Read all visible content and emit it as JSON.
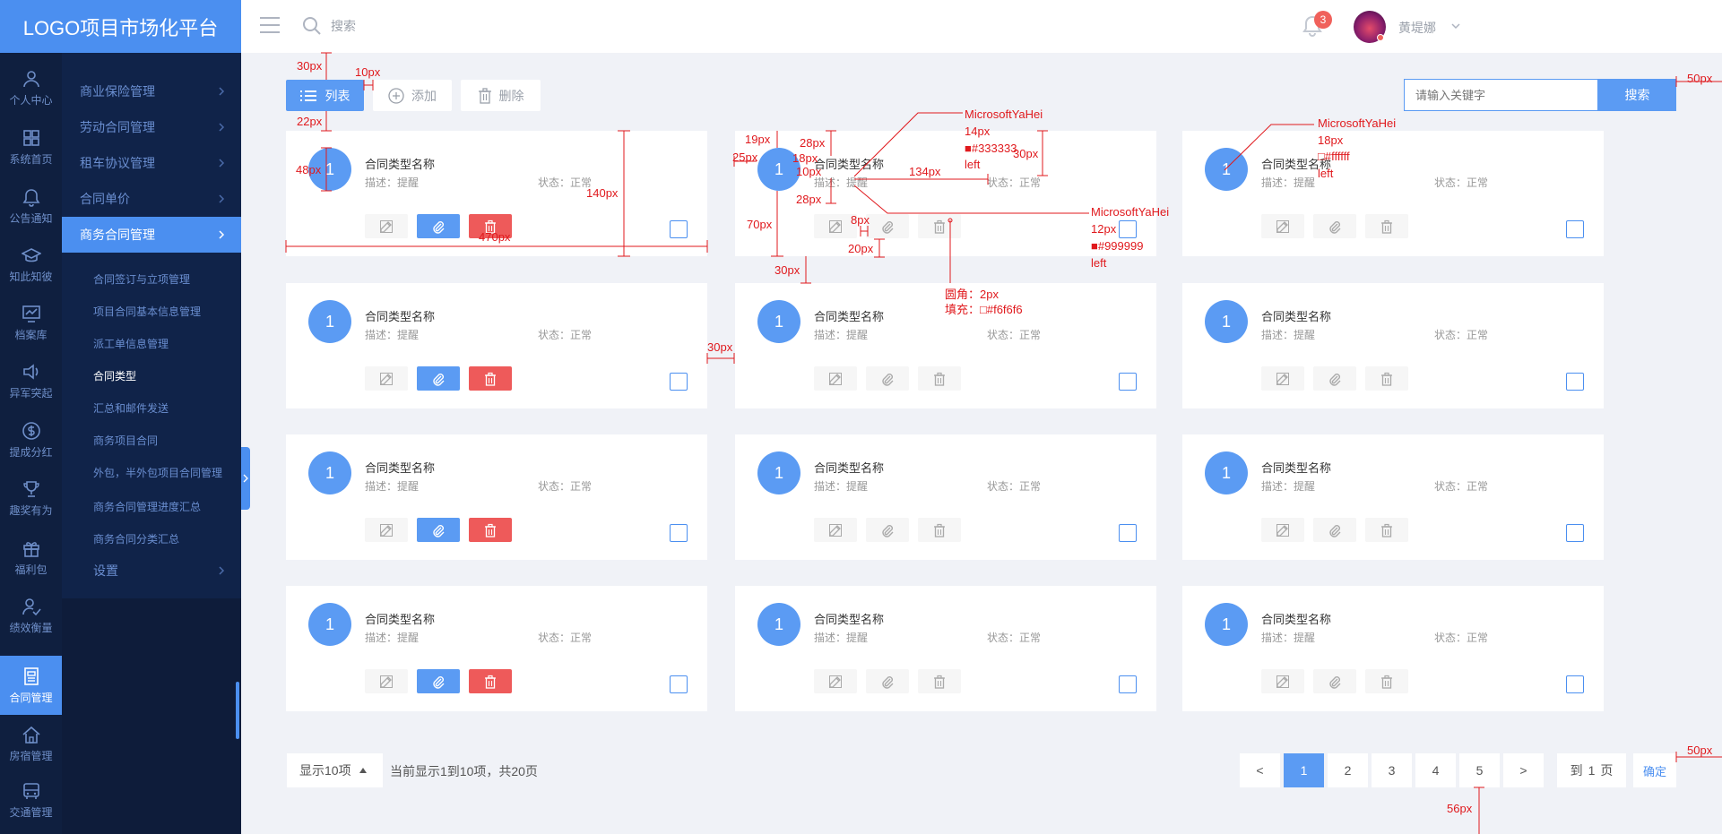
{
  "brand": {
    "title": "LOGO项目市场化平台"
  },
  "header": {
    "search_placeholder": "搜索",
    "notification_count": "3",
    "username": "黄堤娜"
  },
  "iconbar": [
    {
      "label": "个人中心",
      "icon": "user-icon"
    },
    {
      "label": "系统首页",
      "icon": "grid-icon"
    },
    {
      "label": "公告通知",
      "icon": "bell-icon"
    },
    {
      "label": "知此知彼",
      "icon": "graduation-cap-icon"
    },
    {
      "label": "档案库",
      "icon": "monitor-icon"
    },
    {
      "label": "异军突起",
      "icon": "speaker-icon"
    },
    {
      "label": "提成分红",
      "icon": "dollar-icon"
    },
    {
      "label": "趣奖有为",
      "icon": "trophy-icon"
    },
    {
      "label": "福利包",
      "icon": "gift-icon"
    },
    {
      "label": "绩效衡量",
      "icon": "user-check-icon"
    },
    {
      "label": "合同管理",
      "icon": "contract-icon",
      "active": true
    },
    {
      "label": "房宿管理",
      "icon": "home-icon"
    },
    {
      "label": "交通管理",
      "icon": "bus-icon"
    }
  ],
  "subnav": {
    "top_items": [
      "商业保险管理",
      "劳动合同管理",
      "租车协议管理",
      "合同单价"
    ],
    "active_item": "商务合同管理",
    "children": [
      "合同签订与立项管理",
      "项目合同基本信息管理",
      "派工单信息管理",
      "合同类型",
      "汇总和邮件发送",
      "商务项目合同",
      "外包，半外包项目合同管理",
      "商务合同管理进度汇总",
      "商务合同分类汇总"
    ],
    "current_child": "合同类型",
    "settings": "设置"
  },
  "toolbar": {
    "list_label": "列表",
    "add_label": "添加",
    "delete_label": "删除",
    "search_placeholder": "请输入关键字",
    "search_button": "搜索"
  },
  "card_template": {
    "number": "1",
    "title": "合同类型名称",
    "desc": "描述：提醒",
    "status": "状态：正常"
  },
  "cards": [
    {
      "col": 0,
      "row": 0,
      "style": "colored"
    },
    {
      "col": 1,
      "row": 0,
      "style": "plain"
    },
    {
      "col": 2,
      "row": 0,
      "style": "plain"
    },
    {
      "col": 0,
      "row": 1,
      "style": "colored"
    },
    {
      "col": 1,
      "row": 1,
      "style": "plain"
    },
    {
      "col": 2,
      "row": 1,
      "style": "plain"
    },
    {
      "col": 0,
      "row": 2,
      "style": "colored"
    },
    {
      "col": 1,
      "row": 2,
      "style": "plain"
    },
    {
      "col": 2,
      "row": 2,
      "style": "plain"
    },
    {
      "col": 0,
      "row": 3,
      "style": "colored"
    },
    {
      "col": 1,
      "row": 3,
      "style": "plain"
    },
    {
      "col": 2,
      "row": 3,
      "style": "plain"
    }
  ],
  "footer": {
    "show_label": "显示10项",
    "info": "当前显示1到10项，共20页",
    "prev": "<",
    "pages": [
      "1",
      "2",
      "3",
      "4",
      "5"
    ],
    "current_page": "1",
    "next": ">",
    "goto_prefix": "到",
    "goto_value": "1",
    "goto_suffix": "页",
    "confirm": "确定"
  },
  "colors": {
    "primary": "#4b8ff0",
    "sidebar_dark": "#0f1f3f",
    "danger": "#ee5a5a",
    "annotation": "#e0191d",
    "muted_fill": "#f6f6f6"
  },
  "annotations": {
    "labels": [
      "30px",
      "10px",
      "22px",
      "48px",
      "470px",
      "140px",
      "19px",
      "28px",
      "25px",
      "18px",
      "10px",
      "28px",
      "70px",
      "30px",
      "8px",
      "20px",
      "134px",
      "30px",
      "30px",
      "50px",
      "50px",
      "56px"
    ],
    "font_note_1": [
      "MicrosoftYaHei",
      "14px",
      "■#333333",
      "left"
    ],
    "font_note_2": [
      "MicrosoftYaHei",
      "12px",
      "■#999999",
      "left"
    ],
    "font_note_3": [
      "MicrosoftYaHei",
      "18px",
      "□#ffffff",
      "left"
    ],
    "radius_note": [
      "圆角：2px",
      "填充：□#f6f6f6"
    ]
  }
}
